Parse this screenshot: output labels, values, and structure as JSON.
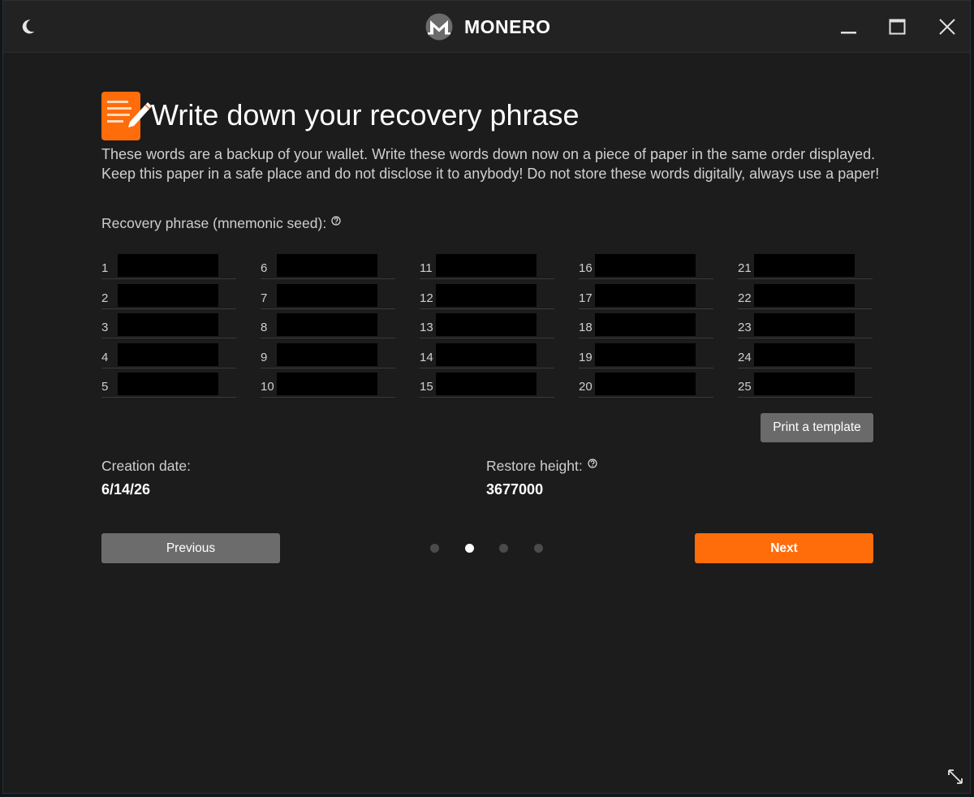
{
  "titlebar": {
    "app_name": "MONERO",
    "icons": {
      "theme": "moon-icon",
      "logo": "monero-logo-icon",
      "minimize": "minimize-icon",
      "maximize": "maximize-icon",
      "close": "close-icon"
    }
  },
  "page": {
    "title": "Write down your recovery phrase",
    "header_icon": "notepad-pencil-icon",
    "description": "These words are a backup of your wallet. Write these words down now on a piece of paper in the same order displayed. Keep this paper in a safe place and do not disclose it to anybody! Do not store these words digitally, always use a paper!"
  },
  "seed": {
    "label": "Recovery phrase (mnemonic seed):",
    "help_icon": "question-circle-icon",
    "words": [
      {
        "num": "1",
        "word": ""
      },
      {
        "num": "2",
        "word": ""
      },
      {
        "num": "3",
        "word": ""
      },
      {
        "num": "4",
        "word": ""
      },
      {
        "num": "5",
        "word": ""
      },
      {
        "num": "6",
        "word": ""
      },
      {
        "num": "7",
        "word": ""
      },
      {
        "num": "8",
        "word": ""
      },
      {
        "num": "9",
        "word": ""
      },
      {
        "num": "10",
        "word": ""
      },
      {
        "num": "11",
        "word": ""
      },
      {
        "num": "12",
        "word": ""
      },
      {
        "num": "13",
        "word": ""
      },
      {
        "num": "14",
        "word": ""
      },
      {
        "num": "15",
        "word": ""
      },
      {
        "num": "16",
        "word": ""
      },
      {
        "num": "17",
        "word": ""
      },
      {
        "num": "18",
        "word": ""
      },
      {
        "num": "19",
        "word": ""
      },
      {
        "num": "20",
        "word": ""
      },
      {
        "num": "21",
        "word": ""
      },
      {
        "num": "22",
        "word": ""
      },
      {
        "num": "23",
        "word": ""
      },
      {
        "num": "24",
        "word": ""
      },
      {
        "num": "25",
        "word": ""
      }
    ],
    "print_label": "Print a template"
  },
  "wallet_info": {
    "creation_date_label": "Creation date:",
    "creation_date": "6/14/26",
    "restore_height_label": "Restore height:",
    "restore_height": "3677000",
    "help_icon": "question-circle-icon"
  },
  "navigation": {
    "previous_label": "Previous",
    "next_label": "Next",
    "step_count": 4,
    "active_step": 2
  },
  "colors": {
    "accent": "#ff6c0a",
    "background": "#1c1c1c",
    "titlebar": "#222222",
    "button_gray": "#6c6c6c"
  },
  "footer": {
    "resize_icon": "resize-diagonal-icon"
  }
}
